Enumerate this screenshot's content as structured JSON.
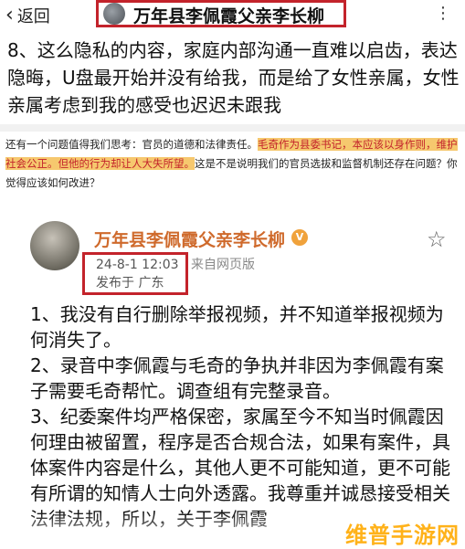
{
  "topbar": {
    "back_label": "返回",
    "title": "万年县李佩霞父亲李长柳",
    "more_label": "⋮"
  },
  "post_excerpt": "8、这么隐私的内容，家庭内部沟通一直难以启齿，表达隐晦，U盘最开始并没有给我，而是给了女性亲属，女性亲属考虑到我的感受也迟迟未跟我",
  "question": {
    "part1": "还有一个问题值得我们思考：官员的道德和法律责任。",
    "highlight_red": "毛奇作为县委书记，本应该以身作则，维护社会公正。但他的行为却让人大失所望。",
    "part2": "这是不是说明我们的官员选拔和监督机制还存在问题？你觉得应该如何改进？"
  },
  "card": {
    "author": "万年县李佩霞父亲李长柳",
    "badge": "V",
    "date": "24-8-1 12:03",
    "source": "来自网页版",
    "location": "发布于 广东",
    "body_lines": [
      "1、我没有自行删除举报视频，并不知道举报视频为何消失了。",
      "2、录音中李佩霞与毛奇的争执并非因为李佩霞有案子需要毛奇帮忙。调查组有完整录音。",
      "3、纪委案件均严格保密，家属至今不知当时佩霞因何理由被留置，程序是否合规合法，如果有案件，具体案件内容是什么，其他人更不可能知道，更不可能有所谓的知情人士向外透露。我尊重并诚恳接受相关法律法规，所以，关于李佩霞"
    ]
  },
  "watermark": "维普手游网",
  "colors": {
    "red_box": "#c3232b",
    "highlight": "#f6c86e",
    "author_orange": "#cf6a2c",
    "watermark": "#ffb21a"
  }
}
